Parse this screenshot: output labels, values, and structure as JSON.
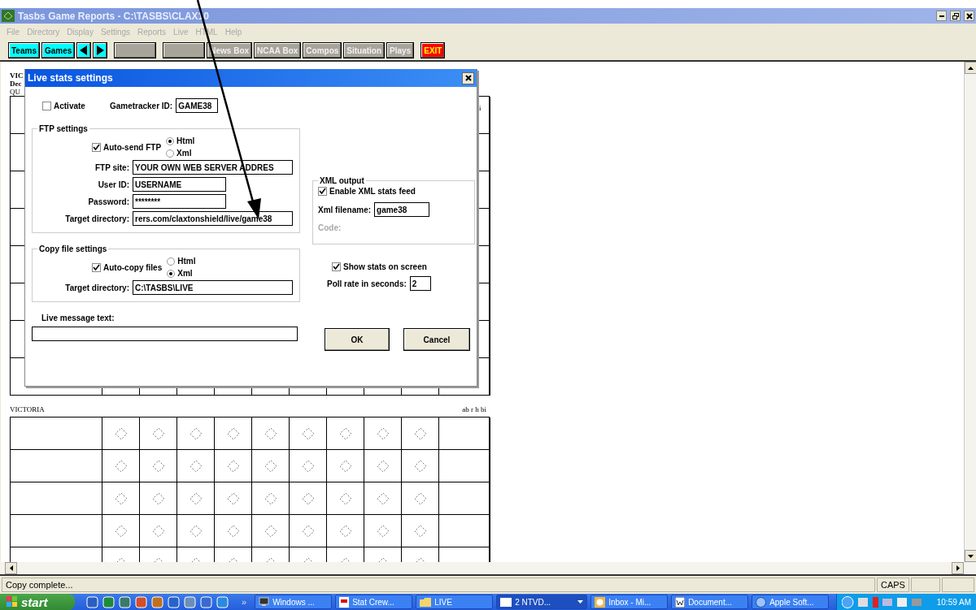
{
  "window": {
    "title": "Tasbs Game Reports - C:\\TASBS\\CLAX10"
  },
  "menu": [
    "File",
    "Directory",
    "Display",
    "Settings",
    "Reports",
    "Live",
    "HTML",
    "Help"
  ],
  "toolbar": [
    {
      "kind": "primary",
      "label": "Teams"
    },
    {
      "kind": "primary",
      "label": "Games"
    },
    {
      "kind": "prev"
    },
    {
      "kind": "next"
    },
    {
      "kind": "blank"
    },
    {
      "kind": "blank"
    },
    {
      "kind": "tool",
      "label": "News Box"
    },
    {
      "kind": "tool",
      "label": "NCAA Box"
    },
    {
      "kind": "tool",
      "label": "Compos"
    },
    {
      "kind": "tool",
      "label": "Situation"
    },
    {
      "kind": "tool",
      "label": "Plays"
    },
    {
      "kind": "exit",
      "label": "EXIT"
    }
  ],
  "scoresheet": {
    "top_team": {
      "lines": [
        "VIC",
        "Dec",
        "QU"
      ],
      "stats_header": "i"
    },
    "bottom_team": {
      "name": "VICTORIA",
      "stats_header": "ab r h bi"
    }
  },
  "dialog": {
    "title": "Live stats settings",
    "activate": {
      "label": "Activate",
      "checked": false
    },
    "gametracker": {
      "label": "Gametracker ID:",
      "value": "GAME38"
    },
    "ftp": {
      "title": "FTP settings",
      "auto": {
        "label": "Auto-send FTP",
        "checked": true
      },
      "formats": [
        {
          "label": "Html",
          "selected": true
        },
        {
          "label": "Xml",
          "selected": false
        }
      ],
      "fields": [
        {
          "label": "FTP site:",
          "value": "YOUR OWN WEB SERVER ADDRES",
          "kind": "wide"
        },
        {
          "label": "User ID:",
          "value": "USERNAME",
          "kind": "short"
        },
        {
          "label": "Password:",
          "value": "********",
          "kind": "short"
        },
        {
          "label": "Target directory:",
          "value": "rers.com/claxtonshield/live/game38",
          "kind": "wide"
        }
      ]
    },
    "copy": {
      "title": "Copy file settings",
      "auto": {
        "label": "Auto-copy files",
        "checked": true
      },
      "formats": [
        {
          "label": "Html",
          "selected": false
        },
        {
          "label": "Xml",
          "selected": true
        }
      ],
      "fields": [
        {
          "label": "Target directory:",
          "value": "C:\\TASBS\\LIVE",
          "kind": "wide"
        }
      ]
    },
    "live_message": {
      "label": "Live message text:"
    },
    "xml": {
      "title": "XML output",
      "enable": {
        "label": "Enable XML stats feed",
        "checked": true
      },
      "filename": {
        "label": "Xml filename:",
        "value": "game38"
      },
      "code": {
        "label": "Code:",
        "disabled": true
      }
    },
    "show_stats": {
      "label": "Show stats on screen",
      "checked": true
    },
    "poll": {
      "label": "Poll rate in seconds:",
      "value": "2"
    },
    "buttons": [
      "OK",
      "Cancel"
    ]
  },
  "status_bar": {
    "message": "Copy complete...",
    "indicators": [
      "CAPS"
    ]
  },
  "taskbar": {
    "start": "start",
    "overflow": "»",
    "tasks": [
      {
        "label": "Windows ...",
        "kind": "monitor",
        "selected": false
      },
      {
        "label": "Stat Crew...",
        "kind": "app",
        "selected": false
      },
      {
        "label": "LIVE",
        "kind": "folder",
        "selected": false
      },
      {
        "label": "2 NTVD...",
        "kind": "group",
        "selected": true
      },
      {
        "label": "Inbox - Mi...",
        "kind": "mail",
        "selected": false
      },
      {
        "label": "Document...",
        "kind": "doc",
        "selected": false
      },
      {
        "label": "Apple Soft...",
        "kind": "globe",
        "selected": false
      }
    ],
    "clock": "10:59 AM"
  }
}
